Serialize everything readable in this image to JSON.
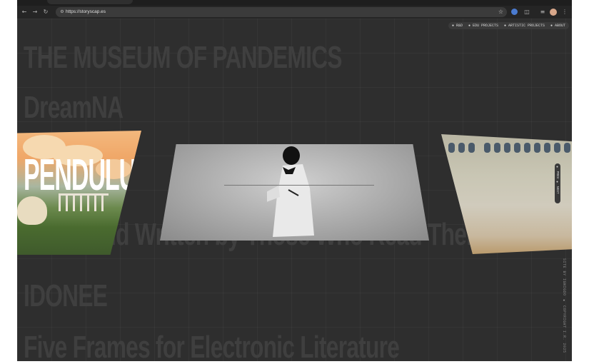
{
  "browser": {
    "url": "https://storyscap.es",
    "site_info_icon": "site-info-icon",
    "bookmark_icon": "star-icon"
  },
  "nav": {
    "items": [
      "● R&D",
      "● EDU PROJECTS",
      "● ARTISTIC PROJECTS",
      "● ABOUT"
    ]
  },
  "projects": {
    "titles": [
      "THE MUSEUM OF PANDEMICS",
      "DreamNA",
      "The World Written by Those Who Read Them",
      "IDONEE",
      "Five Frames for Electronic Literature"
    ]
  },
  "featured": {
    "title": "PENDULUM"
  },
  "side_tag": "● PREV ● NEXT",
  "credit": "SITE BY IGNIGDO ● COPYRIGHT I.R. 2025",
  "colors": {
    "background": "#2e2e2e",
    "title_ghost": "#3f3f3f",
    "nav_pill": "#3a3a3a"
  }
}
